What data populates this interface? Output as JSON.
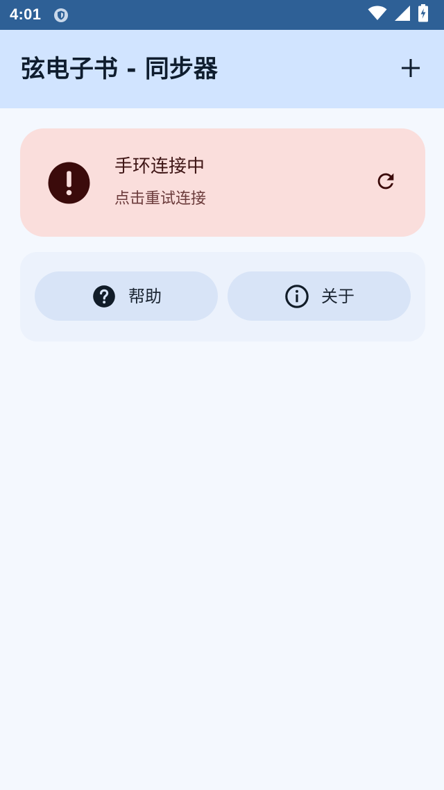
{
  "status_bar": {
    "time": "4:01",
    "icons": [
      "shield-icon",
      "wifi-icon",
      "signal-icon",
      "battery-charging-icon"
    ]
  },
  "app_bar": {
    "title": "弦电子书 - 同步器",
    "add_icon": "plus-icon"
  },
  "connection_card": {
    "title": "手环连接中",
    "subtitle": "点击重试连接",
    "status_icon": "error-icon",
    "action_icon": "refresh-icon",
    "colors": {
      "background": "#fadedc",
      "icon": "#3b0b0b"
    }
  },
  "actions": {
    "help": {
      "label": "帮助",
      "icon": "help-circle-icon"
    },
    "about": {
      "label": "关于",
      "icon": "info-icon"
    }
  },
  "colors": {
    "status_bar": "#2e6096",
    "app_bar": "#d1e4ff",
    "page_background": "#f4f8fe",
    "pill_background": "#d8e4f7"
  }
}
